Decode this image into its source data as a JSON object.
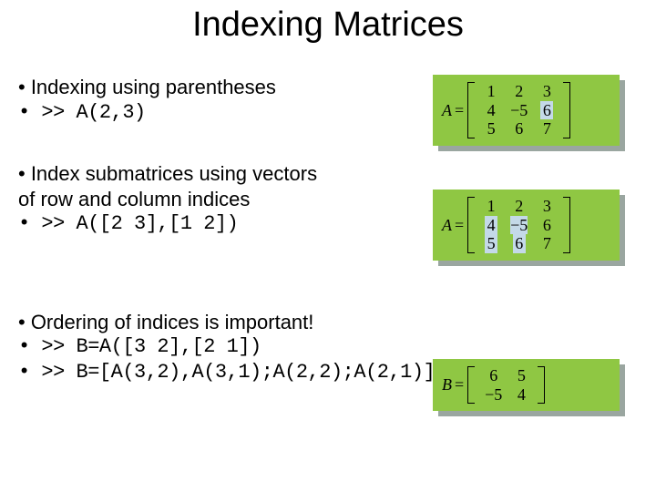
{
  "title": "Indexing Matrices",
  "block1": {
    "line1": "• Indexing using parentheses",
    "line2": "• >> A(2,3)"
  },
  "block2": {
    "line1": "• Index submatrices using vectors",
    "line2": "of row and column indices",
    "line3": "• >> A([2 3],[1 2])"
  },
  "block3": {
    "line1": "• Ordering of indices is important!",
    "line2": "• >> B=A([3 2],[2 1])",
    "line3": "• >> B=[A(3,2),A(3,1);A(2,2);A(2,1)]"
  },
  "matrixA": {
    "lhs": "A",
    "r1c1": "1",
    "r1c2": "2",
    "r1c3": "3",
    "r2c1": "4",
    "r2c2": "−5",
    "r2c3": "6",
    "r3c1": "5",
    "r3c2": "6",
    "r3c3": "7"
  },
  "matrixB": {
    "lhs": "B",
    "r1c1": "6",
    "r1c2": "5",
    "r2c1": "−5",
    "r2c2": "4"
  }
}
